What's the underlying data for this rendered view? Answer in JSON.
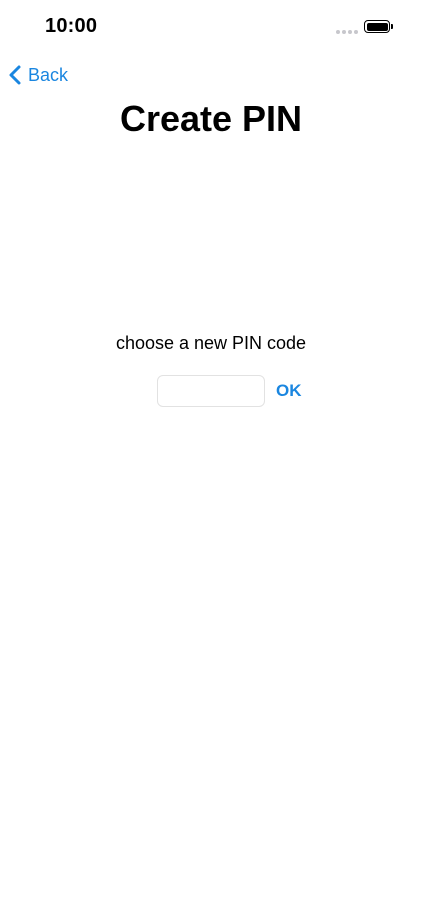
{
  "status_bar": {
    "time": "10:00",
    "signal_icon": "signal-dots-icon",
    "battery_icon": "battery-icon"
  },
  "nav": {
    "back_label": "Back",
    "back_icon": "chevron-left-icon"
  },
  "page": {
    "title": "Create PIN",
    "prompt": "choose a new PIN code"
  },
  "pin_form": {
    "input_value": "",
    "input_placeholder": "",
    "ok_label": "OK"
  },
  "colors": {
    "accent": "#1a86e0",
    "text": "#000000",
    "background": "#ffffff",
    "input_border": "#e2e2e2"
  }
}
